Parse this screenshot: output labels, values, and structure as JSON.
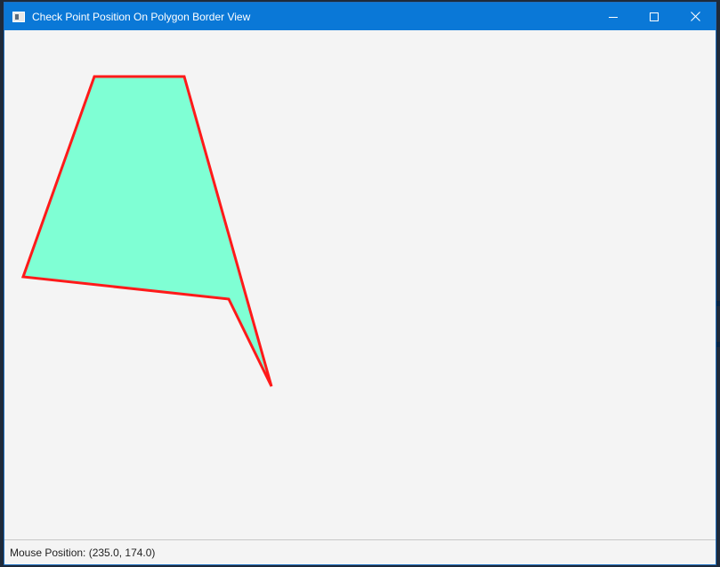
{
  "window": {
    "title": "Check Point Position On Polygon Border View",
    "controls": {
      "minimize": "minimize-icon",
      "maximize": "maximize-icon",
      "close": "close-icon"
    }
  },
  "polygon": {
    "fill_color": "#7fffd4",
    "stroke_color": "#ff1a1a"
  },
  "status": {
    "mouse_position": "Mouse Position: (235.0, 174.0)"
  }
}
